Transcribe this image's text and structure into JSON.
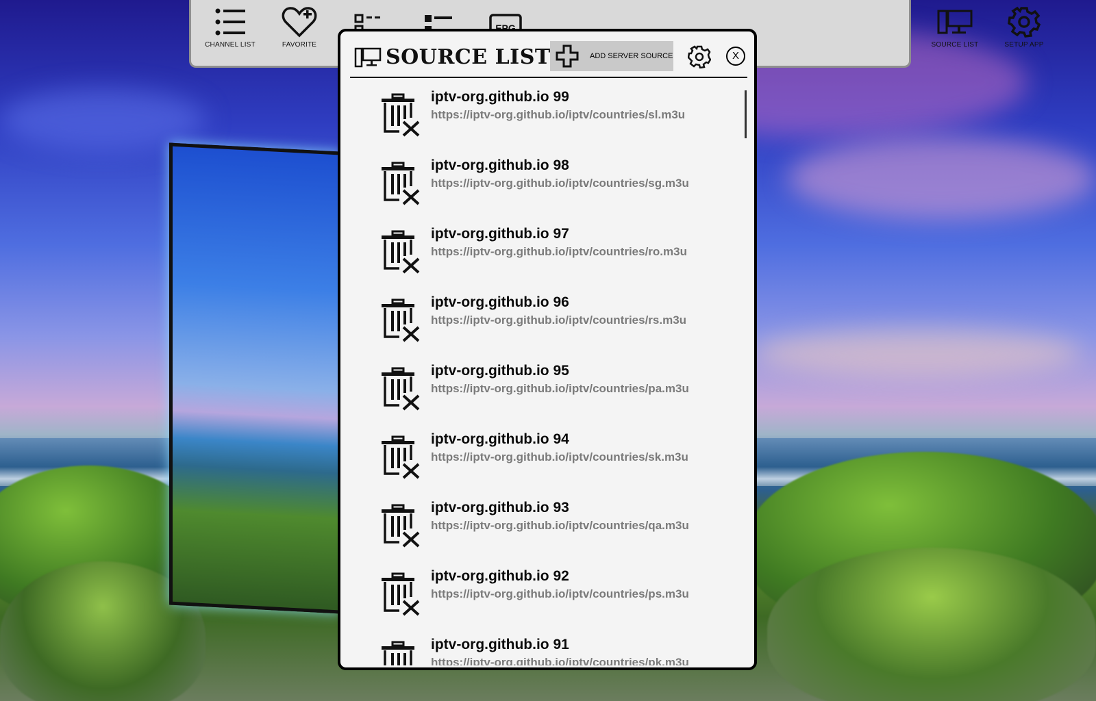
{
  "toolbar": {
    "items": [
      {
        "label": "CHANNEL LIST",
        "icon": "list-icon"
      },
      {
        "label": "FAVORITE",
        "icon": "heart-plus-icon"
      },
      {
        "label": "",
        "icon": "grid-list-icon"
      },
      {
        "label": "",
        "icon": "list-detail-icon"
      },
      {
        "label": "",
        "icon": "epg-icon",
        "text": "EPG"
      },
      {
        "label": "",
        "icon": "window-icon"
      },
      {
        "label": "",
        "icon": "clipboard-icon"
      },
      {
        "label": "",
        "icon": "film-icon"
      },
      {
        "label": "SOURCE LIST",
        "icon": "monitor-icon"
      },
      {
        "label": "SETUP APP",
        "icon": "gear-icon"
      }
    ]
  },
  "dialog": {
    "title": "SOURCE LIST",
    "add_button_label": "ADD SERVER SOURCE",
    "close_label": "X"
  },
  "sources": [
    {
      "name": "iptv-org.github.io 99",
      "url": "https://iptv-org.github.io/iptv/countries/sl.m3u"
    },
    {
      "name": "iptv-org.github.io 98",
      "url": "https://iptv-org.github.io/iptv/countries/sg.m3u"
    },
    {
      "name": "iptv-org.github.io 97",
      "url": "https://iptv-org.github.io/iptv/countries/ro.m3u"
    },
    {
      "name": "iptv-org.github.io 96",
      "url": "https://iptv-org.github.io/iptv/countries/rs.m3u"
    },
    {
      "name": "iptv-org.github.io 95",
      "url": "https://iptv-org.github.io/iptv/countries/pa.m3u"
    },
    {
      "name": "iptv-org.github.io 94",
      "url": "https://iptv-org.github.io/iptv/countries/sk.m3u"
    },
    {
      "name": "iptv-org.github.io 93",
      "url": "https://iptv-org.github.io/iptv/countries/qa.m3u"
    },
    {
      "name": "iptv-org.github.io 92",
      "url": "https://iptv-org.github.io/iptv/countries/ps.m3u"
    },
    {
      "name": "iptv-org.github.io 91",
      "url": "https://iptv-org.github.io/iptv/countries/pk.m3u"
    }
  ]
}
